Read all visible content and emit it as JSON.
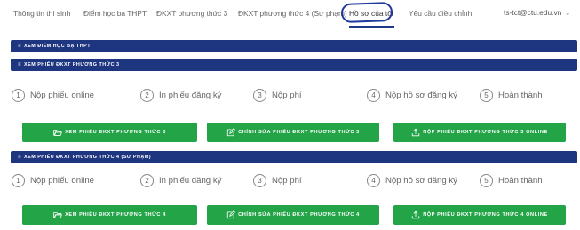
{
  "nav": {
    "items": [
      "Thông tin thí sinh",
      "Điểm học bạ THPT",
      "ĐKXT phương thức 3",
      "ĐKXT phương thức 4 (Sư phạm)",
      "Hồ sơ của tôi",
      "Yêu cầu điều chỉnh"
    ],
    "active": "Hồ sơ của tôi",
    "account": "ts-tct@ctu.edu.vn",
    "highlight_color": "#1e3a9c"
  },
  "sections": {
    "hoc_ba": "XEM ĐIỂM HỌC BẠ THPT",
    "pt3": "XEM PHIẾU ĐKXT PHƯƠNG THỨC 3",
    "pt4": "XEM PHIẾU ĐKXT PHƯƠNG THỨC 4 (SƯ PHẠM)"
  },
  "steps_pt3": [
    {
      "num": "1",
      "label": "Nộp phiếu online"
    },
    {
      "num": "2",
      "label": "In phiếu đăng ký"
    },
    {
      "num": "3",
      "label": "Nộp phí"
    },
    {
      "num": "4",
      "label": "Nộp hồ sơ đăng ký"
    },
    {
      "num": "5",
      "label": "Hoàn thành"
    }
  ],
  "steps_pt4": [
    {
      "num": "1",
      "label": "Nộp phiếu online"
    },
    {
      "num": "2",
      "label": "In phiếu đăng ký"
    },
    {
      "num": "3",
      "label": "Nộp phí"
    },
    {
      "num": "4",
      "label": "Nộp hồ sơ đăng ký"
    },
    {
      "num": "5",
      "label": "Hoàn thành"
    }
  ],
  "buttons_pt3": {
    "view": "XEM PHIẾU ĐKXT PHƯƠNG THỨC 3",
    "edit": "CHỈNH SỬA PHIẾU ĐKXT PHƯƠNG THỨC 3",
    "submit": "NỘP PHIẾU ĐKXT PHƯƠNG THỨC 3 ONLINE"
  },
  "buttons_pt4": {
    "view": "XEM PHIẾU ĐKXT PHƯƠNG THỨC 4",
    "edit": "CHỈNH SỬA PHIẾU ĐKXT PHƯƠNG THỨC 4",
    "submit": "NỘP PHIẾU ĐKXT PHƯƠNG THỨC 4 ONLINE"
  },
  "colors": {
    "section_bar": "#1e3580",
    "button_green": "#22a447"
  },
  "icons": {
    "section": "bars-icon",
    "view": "folder-open-icon",
    "edit": "edit-icon",
    "submit": "upload-icon",
    "account_chevron": "chevron-down-icon"
  }
}
